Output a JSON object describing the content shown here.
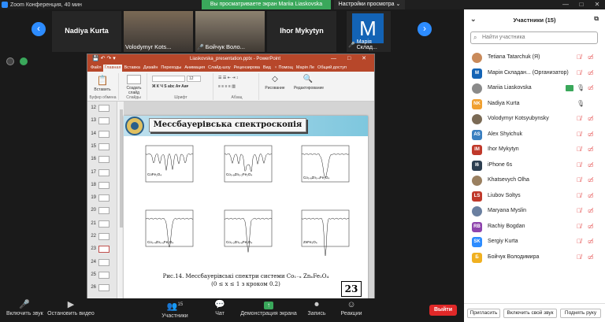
{
  "window": {
    "title": "Zoom Конференция, 40 мин",
    "controls": [
      "—",
      "□",
      "✕"
    ]
  },
  "banner": {
    "text": "Вы просматриваете экран Mariia Liaskovska",
    "view_options": "Настройки просмотра ⌄"
  },
  "filmstrip": {
    "prev_icon": "‹",
    "next_icon": "›",
    "tiles": [
      {
        "name": "Nadiya Kurta",
        "caption": ""
      },
      {
        "name": "",
        "caption": "Volodymyr Kots..."
      },
      {
        "name": "",
        "caption": "Бойчук Воло..."
      },
      {
        "name": "Ihor Mykytyn",
        "caption": ""
      },
      {
        "name": "",
        "caption": "Марія Склад...",
        "avatar_letter": "M"
      }
    ]
  },
  "ppt": {
    "file_name": "Liaskovska_presentation.pptx - PowerPoint",
    "tabs": [
      "Файл",
      "Главная",
      "Вставка",
      "Дизайн",
      "Переходы",
      "Анимация",
      "Слайд-шоу",
      "Рецензирова",
      "Вид",
      "♀ Помощ",
      "Марія Ле",
      "Общий доступ"
    ],
    "ribbon": {
      "paste": "Вставить",
      "clipboard": "Буфер обмена",
      "new_slide": "Создать слайд",
      "slides": "Слайды",
      "font": "Шрифт",
      "font_size": "12",
      "paragraph": "Абзац",
      "drawing": "Рисование",
      "editing": "Редактирование"
    },
    "thumb_numbers": [
      "12",
      "13",
      "14",
      "15",
      "16",
      "17",
      "18",
      "19",
      "20",
      "21",
      "22",
      "23",
      "24",
      "25",
      "26"
    ],
    "selected_thumb": "23",
    "slide": {
      "title": "Мессбауерівська спектроскопія",
      "spectra_labels": [
        "CoFe₂O₄",
        "Co₀.₈Zn₀.₂Fe₂O₄",
        "Co₀.₆Zn₀.₄Fe₂O₄",
        "Co₀.₄Zn₀.₆Fe₂O₄",
        "Co₀.₂Zn₀.₈Fe₂O₄",
        "ZnFe₂O₄"
      ],
      "caption": "Рис.14. Мессбауерівські спектри системи Co₁₋ₓ ZnₓFe₂O₄",
      "caption_sub": "(0 ≤ x ≤ 1 з кроком 0.2)",
      "number": "23"
    }
  },
  "toolbar": {
    "mute": "Включить звук",
    "video": "Остановить видео",
    "participants": "Участники",
    "participants_count": "15",
    "chat": "Чат",
    "share": "Демонстрация экрана",
    "record": "Запись",
    "reactions": "Реакции",
    "leave": "Выйти"
  },
  "panel": {
    "title": "Участники (15)",
    "search_placeholder": "Найти участника",
    "participants": [
      {
        "name": "Tetiana Tatarchuk (Я)",
        "initials": "",
        "color": "#c98a5a",
        "mic": "off",
        "cam": "off"
      },
      {
        "name": "Марія Складан... (Организатор)",
        "initials": "M",
        "color": "#1363b5",
        "mic": "off",
        "cam": "off"
      },
      {
        "name": "Mariia Liaskovska",
        "initials": "",
        "color": "#8a8a8a",
        "mic": "on",
        "cam": "off",
        "sharing": true
      },
      {
        "name": "Nadiya Kurta",
        "initials": "NK",
        "color": "#f0a030",
        "mic": "on",
        "cam": "none"
      },
      {
        "name": "Volodymyr Kotsyubynsky",
        "initials": "",
        "color": "#7a6a55",
        "mic": "off",
        "cam": "off"
      },
      {
        "name": "Alex Shyichuk",
        "initials": "AS",
        "color": "#3a7fc0",
        "mic": "off",
        "cam": "off"
      },
      {
        "name": "Ihor Mykytyn",
        "initials": "IM",
        "color": "#c0392b",
        "mic": "off",
        "cam": "off"
      },
      {
        "name": "iPhone 6s",
        "initials": "I6",
        "color": "#2c3e50",
        "mic": "off",
        "cam": "off"
      },
      {
        "name": "Khatsevych Olha",
        "initials": "",
        "color": "#9a8060",
        "mic": "off",
        "cam": "off"
      },
      {
        "name": "Liubov Soltys",
        "initials": "LS",
        "color": "#c0392b",
        "mic": "off",
        "cam": "off"
      },
      {
        "name": "Maryana Myslin",
        "initials": "",
        "color": "#6a7fa0",
        "mic": "off",
        "cam": "off"
      },
      {
        "name": "Rachiy Bogdan",
        "initials": "RB",
        "color": "#8e44ad",
        "mic": "off",
        "cam": "off"
      },
      {
        "name": "Sergiy Kurta",
        "initials": "SK",
        "color": "#2d8cff",
        "mic": "off",
        "cam": "off"
      },
      {
        "name": "Бойчук Володимира",
        "initials": "Б",
        "color": "#f0b020",
        "mic": "off",
        "cam": "off"
      }
    ],
    "buttons": [
      "Пригласить",
      "Включить свой звук",
      "Поднять руку"
    ]
  }
}
